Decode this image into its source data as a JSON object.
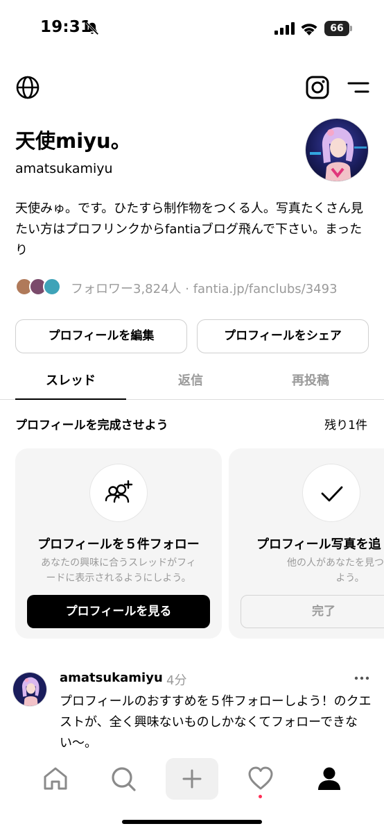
{
  "status_bar": {
    "time": "19:31",
    "battery": "66"
  },
  "profile": {
    "display_name": "天使miyu。",
    "username": "amatsukamiyu",
    "bio": "天使みゅ。です。ひたすら制作物をつくる人。写真たくさん見たい方はプロフリンクからfantiaブログ飛んで下さい。まったり",
    "followers_text": "フォロワー3,824人 · fantia.jp/fanclubs/3493",
    "edit_button": "プロフィールを編集",
    "share_button": "プロフィールをシェア"
  },
  "tabs": [
    {
      "label": "スレッド",
      "active": true
    },
    {
      "label": "返信",
      "active": false
    },
    {
      "label": "再投稿",
      "active": false
    }
  ],
  "complete_profile": {
    "title": "プロフィールを完成させよう",
    "remaining": "残り1件",
    "cards": [
      {
        "icon": "add-people-icon",
        "title": "プロフィールを５件フォロー",
        "desc_line1": "あなたの興味に合うスレッドがフィ",
        "desc_line2": "ードに表示されるようにしよう。",
        "button": "プロフィールを見る"
      },
      {
        "icon": "check-icon",
        "title": "プロフィール写真を追",
        "desc_line1": "他の人があなたを見つけやす",
        "desc_line2": "よう。",
        "button": "完了"
      }
    ]
  },
  "post": {
    "user": "amatsukamiyu",
    "time": "4分",
    "text": "プロフィールのおすすめを５件フォローしよう！のクエストが、全く興味ないものしかなくてフォローできない〜。"
  },
  "colors": {
    "accent_dot": "#ff2e55",
    "muted_text": "#9a9a9a"
  }
}
